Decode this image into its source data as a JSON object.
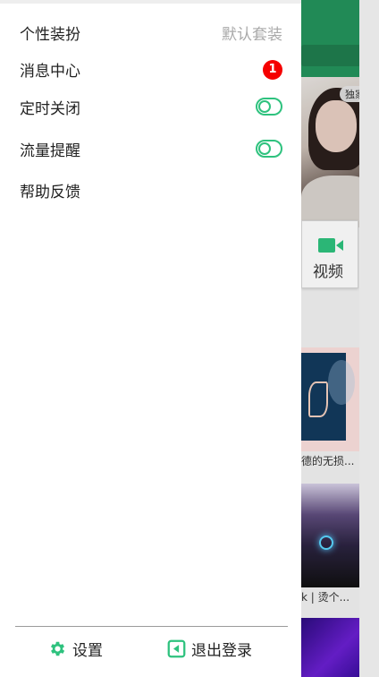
{
  "drawer": {
    "menu": [
      {
        "label": "个性装扮",
        "value": "默认套装"
      },
      {
        "label": "消息中心",
        "badge": "1"
      },
      {
        "label": "定时关闭",
        "toggle": false
      },
      {
        "label": "流量提醒",
        "toggle": false
      },
      {
        "label": "帮助反馈"
      }
    ],
    "footer": {
      "settings_label": "设置",
      "logout_label": "退出登录"
    }
  },
  "background": {
    "banner_badge": "独家",
    "video_label": "视频",
    "caption_1": "德的无损...",
    "caption_2": "k | 烫个..."
  },
  "colors": {
    "accent": "#2ec27e",
    "header_green": "#24935c",
    "badge_red": "#f50000"
  },
  "icons": [
    "gear-icon",
    "logout-icon",
    "video-camera-icon"
  ]
}
